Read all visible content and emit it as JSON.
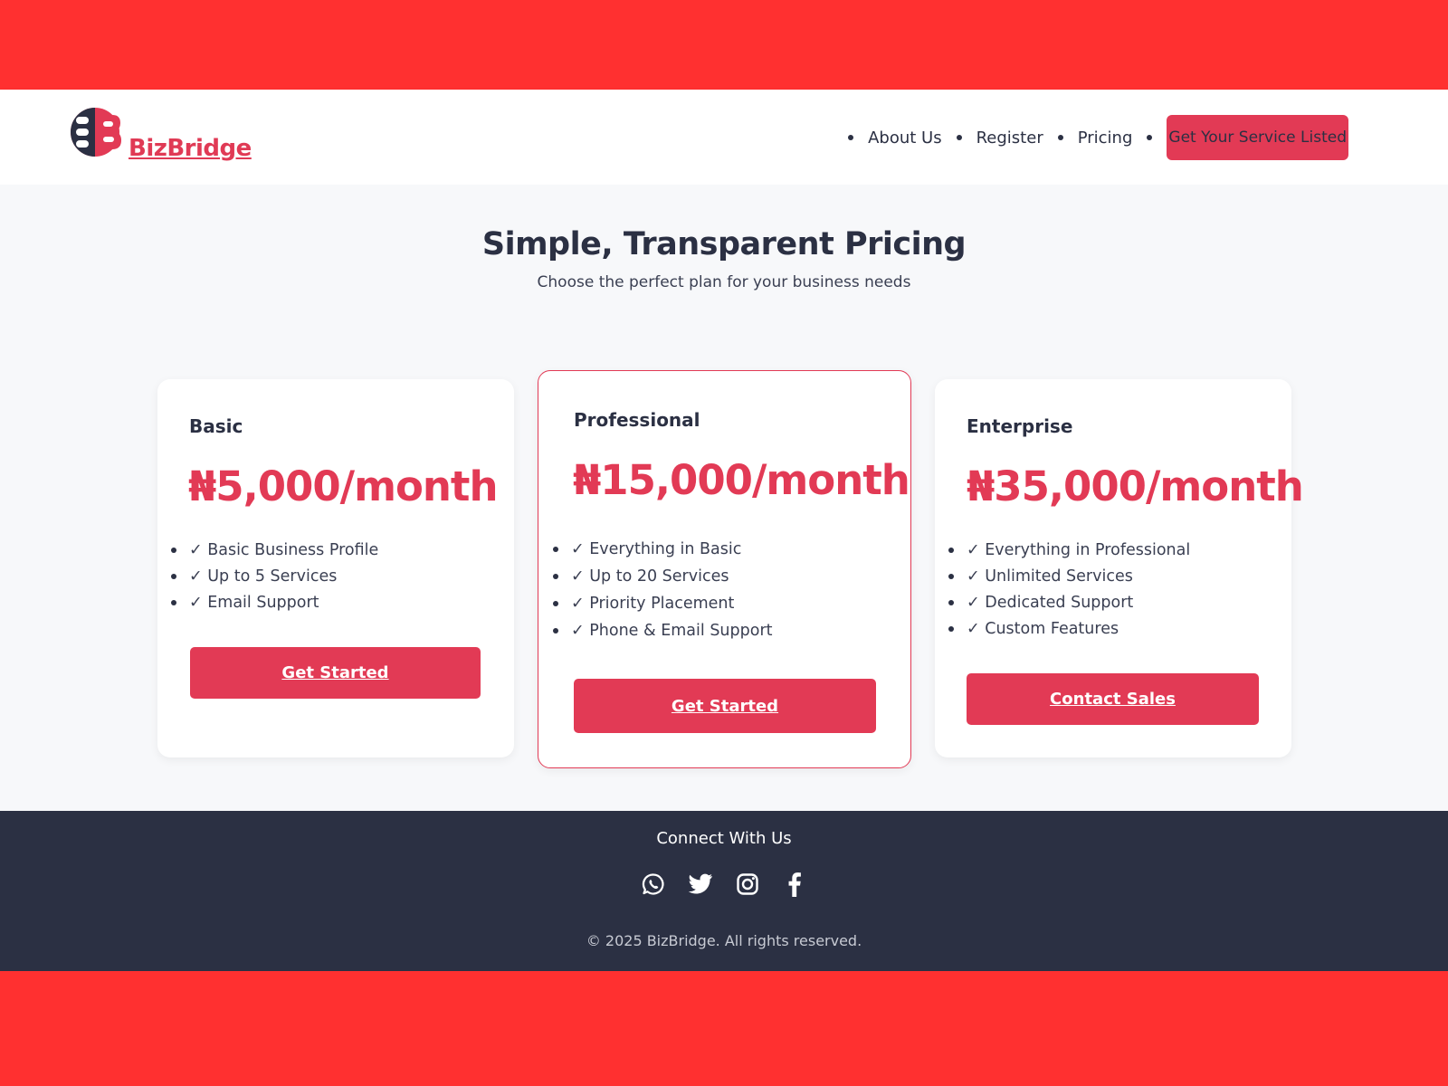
{
  "brand": {
    "name": "BizBridge"
  },
  "nav": {
    "items": [
      {
        "label": "About Us"
      },
      {
        "label": "Register"
      },
      {
        "label": "Pricing"
      }
    ],
    "cta_label": "Get Your Service Listed"
  },
  "hero": {
    "title": "Simple, Transparent Pricing",
    "subtitle": "Choose the perfect plan for your business needs"
  },
  "plans": [
    {
      "name": "Basic",
      "price": "₦5,000/month",
      "features": [
        "✓ Basic Business Profile",
        "✓ Up to 5 Services",
        "✓ Email Support"
      ],
      "button_label": "Get Started"
    },
    {
      "name": "Professional",
      "price": "₦15,000/month",
      "features": [
        "✓ Everything in Basic",
        "✓ Up to 20 Services",
        "✓ Priority Placement",
        "✓ Phone & Email Support"
      ],
      "button_label": "Get Started",
      "featured": true
    },
    {
      "name": "Enterprise",
      "price": "₦35,000/month",
      "features": [
        "✓ Everything in Professional",
        "✓ Unlimited Services",
        "✓ Dedicated Support",
        "✓ Custom Features"
      ],
      "button_label": "Contact Sales"
    }
  ],
  "footer": {
    "title": "Connect With Us",
    "socials": [
      "whatsapp-icon",
      "twitter-icon",
      "instagram-icon",
      "facebook-icon"
    ],
    "copyright": "© 2025 BizBridge. All rights reserved."
  },
  "colors": {
    "accent": "#e23a55",
    "dark": "#2b3043",
    "frame": "#ff3030",
    "background": "#f7f8fa"
  }
}
